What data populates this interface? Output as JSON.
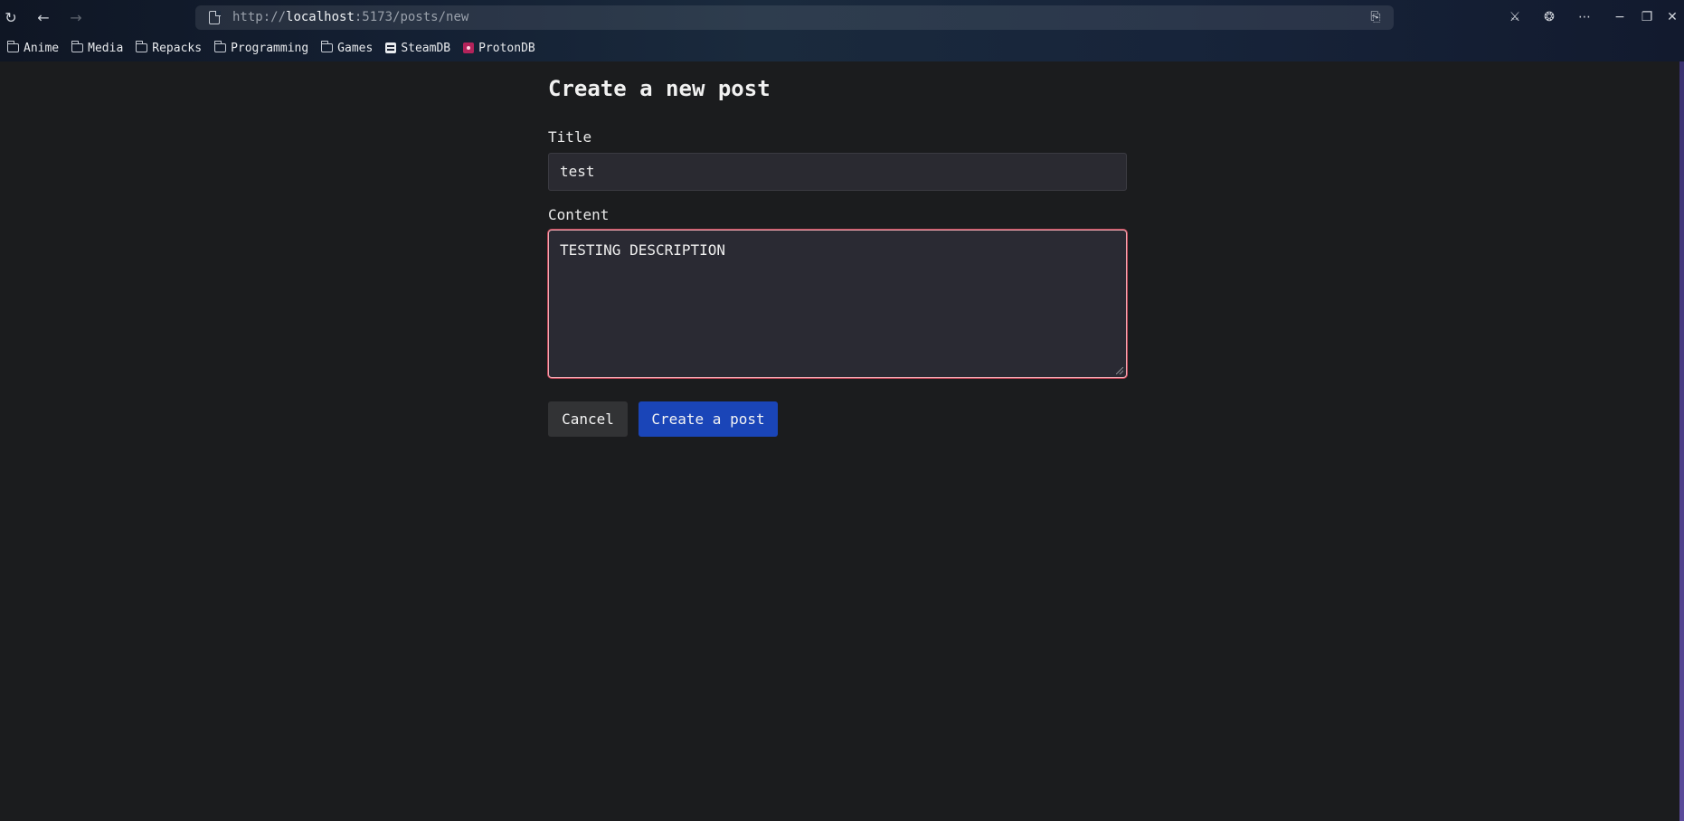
{
  "browser": {
    "url_scheme": "http://",
    "url_host": "localhost",
    "url_path": ":5173/posts/new",
    "bookmarks": [
      {
        "label": "Anime",
        "icon": "folder-icon"
      },
      {
        "label": "Media",
        "icon": "folder-icon"
      },
      {
        "label": "Repacks",
        "icon": "folder-icon"
      },
      {
        "label": "Programming",
        "icon": "folder-icon"
      },
      {
        "label": "Games",
        "icon": "folder-icon"
      },
      {
        "label": "SteamDB",
        "icon": "steamdb-icon"
      },
      {
        "label": "ProtonDB",
        "icon": "protondb-icon"
      }
    ]
  },
  "form": {
    "heading": "Create a new post",
    "title_label": "Title",
    "title_value": "test",
    "content_label": "Content",
    "content_value": "TESTING DESCRIPTION",
    "cancel_label": "Cancel",
    "submit_label": "Create a post"
  },
  "colors": {
    "page_background": "#1b1c1e",
    "submit_button": "#1a45b8",
    "focus_outline": "#c2485a"
  }
}
